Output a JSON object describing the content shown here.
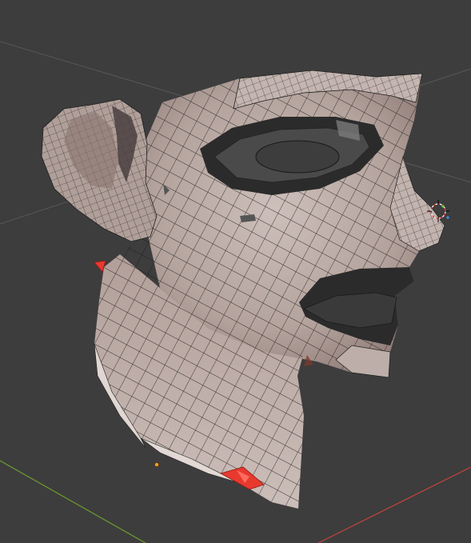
{
  "viewport": {
    "background_color": "#3d3d3d",
    "grid_line_color": "#5a5a5a",
    "x_axis_color": "#c8423c",
    "y_axis_color": "#6d9a2f",
    "skin_color": "#b8a8a2",
    "skin_shadow_color": "#6a5550",
    "cavity_color": "#2b2b2b",
    "wire_color": "#1e1e1e",
    "selection_color": "#e8392f",
    "origin_color": "#f59b24",
    "model": "head-mesh",
    "icons": [
      "3d-cursor-icon",
      "object-origin-icon"
    ]
  }
}
